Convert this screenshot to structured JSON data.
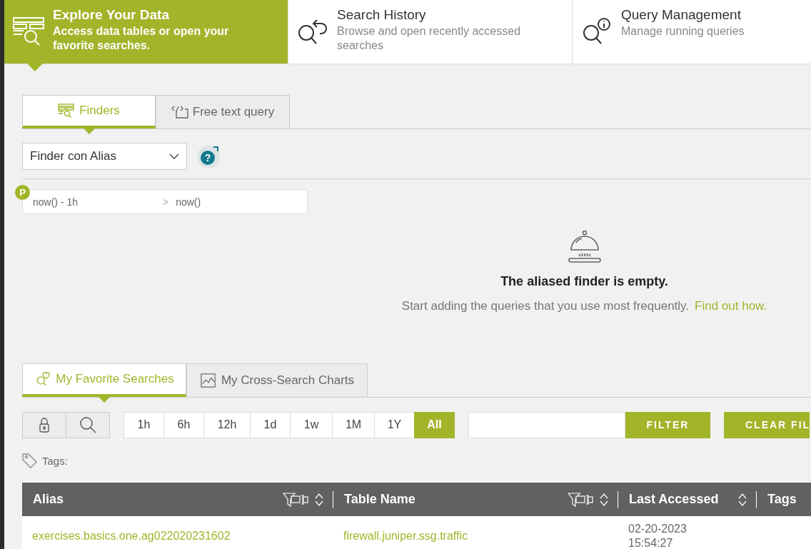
{
  "nav_tabs": [
    {
      "kind": "explore",
      "title": "Explore Your Data",
      "subtitle": "Access data tables or open your favorite searches.",
      "selected": true
    },
    {
      "kind": "history",
      "title": "Search History",
      "subtitle": "Browse and open recently accessed searches",
      "selected": false
    },
    {
      "kind": "queries",
      "title": "Query Management",
      "subtitle": "Manage running queries",
      "selected": false
    }
  ],
  "finder_tabs": [
    {
      "kind": "finders",
      "label": "Finders",
      "selected": true
    },
    {
      "kind": "code",
      "label": "Free text query",
      "selected": false
    }
  ],
  "finder_select": {
    "value": "Finder con Alias"
  },
  "help_button": {
    "label": "?"
  },
  "time_range": {
    "badge": "P",
    "from": "now() - 1h",
    "separator": ">",
    "to": "now()"
  },
  "empty_state": {
    "title": "The aliased finder is empty.",
    "text": "Start adding the queries that you use most frequently.",
    "link": "Find out how."
  },
  "favorites_tabs": [
    {
      "kind": "favorites",
      "label": "My Favorite Searches",
      "selected": true
    },
    {
      "kind": "chart",
      "label": "My Cross-Search Charts",
      "selected": false
    }
  ],
  "time_buttons": [
    {
      "label": "1h",
      "selected": false
    },
    {
      "label": "6h",
      "selected": false
    },
    {
      "label": "12h",
      "selected": false
    },
    {
      "label": "1d",
      "selected": false
    },
    {
      "label": "1w",
      "selected": false
    },
    {
      "label": "1M",
      "selected": false
    },
    {
      "label": "1Y",
      "selected": false
    },
    {
      "label": "All",
      "selected": true
    }
  ],
  "filter": {
    "button": "FILTER",
    "clear_button": "CLEAR FIL"
  },
  "tags_label": "Tags:",
  "table": {
    "columns": [
      {
        "label": "Alias",
        "filterable": true,
        "sortable": true
      },
      {
        "label": "Table Name",
        "filterable": true,
        "sortable": true
      },
      {
        "label": "Last Accessed",
        "filterable": false,
        "sortable": true
      },
      {
        "label": "Tags",
        "filterable": false,
        "sortable": false
      }
    ],
    "rows": [
      {
        "alias": "exercises.basics.one.ag022020231602",
        "table_name": "firewall.juniper.ssg.traffic",
        "last_accessed": "02-20-2023 15:54:27"
      }
    ]
  }
}
